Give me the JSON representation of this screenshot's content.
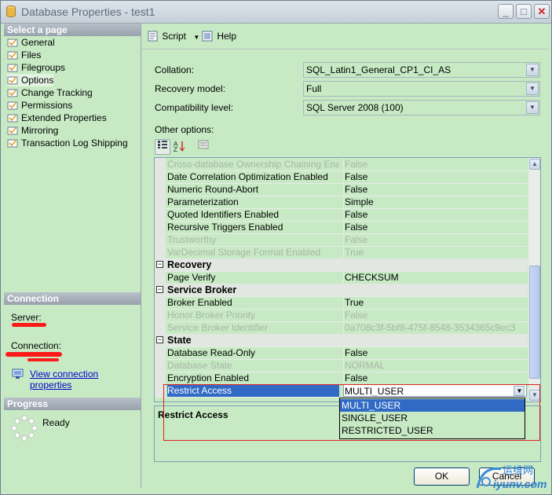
{
  "window": {
    "title": "Database Properties - test1",
    "buttons": {
      "minimize": "_",
      "maximize": "□",
      "close": "✕"
    }
  },
  "left": {
    "select_page_header": "Select a page",
    "pages": [
      {
        "label": "General"
      },
      {
        "label": "Files"
      },
      {
        "label": "Filegroups"
      },
      {
        "label": "Options"
      },
      {
        "label": "Change Tracking"
      },
      {
        "label": "Permissions"
      },
      {
        "label": "Extended Properties"
      },
      {
        "label": "Mirroring"
      },
      {
        "label": "Transaction Log Shipping"
      }
    ],
    "connection_header": "Connection",
    "server_label": "Server:",
    "connection_label": "Connection:",
    "view_connection_link": "View connection properties",
    "progress_header": "Progress",
    "progress_status": "Ready"
  },
  "toolbar": {
    "script_label": "Script",
    "help_label": "Help"
  },
  "form": {
    "collation_label": "Collation:",
    "collation_value": "SQL_Latin1_General_CP1_CI_AS",
    "recovery_label": "Recovery model:",
    "recovery_value": "Full",
    "compat_label": "Compatibility level:",
    "compat_value": "SQL Server 2008 (100)",
    "other_options_label": "Other options:"
  },
  "grid": {
    "rows": [
      {
        "name": "Cross-database Ownership Chaining Enabled",
        "value": "False",
        "disabled": true
      },
      {
        "name": "Date Correlation Optimization Enabled",
        "value": "False"
      },
      {
        "name": "Numeric Round-Abort",
        "value": "False"
      },
      {
        "name": "Parameterization",
        "value": "Simple"
      },
      {
        "name": "Quoted Identifiers Enabled",
        "value": "False"
      },
      {
        "name": "Recursive Triggers Enabled",
        "value": "False"
      },
      {
        "name": "Trustworthy",
        "value": "False",
        "disabled": true
      },
      {
        "name": "VarDecimal Storage Format Enabled",
        "value": "True",
        "disabled": true
      },
      {
        "category": "Recovery"
      },
      {
        "name": "Page Verify",
        "value": "CHECKSUM"
      },
      {
        "category": "Service Broker"
      },
      {
        "name": "Broker Enabled",
        "value": "True"
      },
      {
        "name": "Honor Broker Priority",
        "value": "False",
        "disabled": true
      },
      {
        "name": "Service Broker Identifier",
        "value": "0a708c3f-5bf8-475f-8548-3534365c9ec3",
        "disabled": true
      },
      {
        "category": "State"
      },
      {
        "name": "Database Read-Only",
        "value": "False"
      },
      {
        "name": "Database State",
        "value": "NORMAL",
        "disabled": true
      },
      {
        "name": "Encryption Enabled",
        "value": "False"
      },
      {
        "name": "Restrict Access",
        "value": "MULTI_USER",
        "selected": true
      }
    ]
  },
  "dropdown": {
    "options": [
      "MULTI_USER",
      "SINGLE_USER",
      "RESTRICTED_USER"
    ],
    "selected": "MULTI_USER"
  },
  "description": {
    "title": "Restrict Access"
  },
  "buttons": {
    "ok": "OK",
    "cancel": "Cancel"
  },
  "watermark": {
    "text_cn": "运维网",
    "text_en": "iyunv.com"
  },
  "colors": {
    "accent": "#316ac5",
    "background": "#c7eac4",
    "annotation": "#dd2222"
  }
}
